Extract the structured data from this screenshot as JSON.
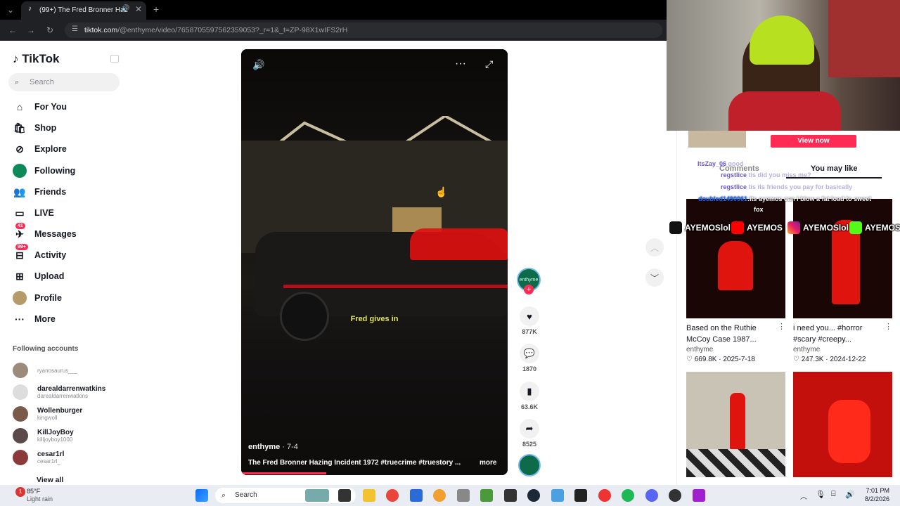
{
  "browser": {
    "tab_title": "(99+) The Fred Bronner Haz",
    "url_main": "tiktok.com",
    "url_rest": "/@enthyme/video/7658705597562359053?_r=1&_t=ZP-98X1wIFS2rH"
  },
  "sidebar": {
    "logo": "TikTok",
    "search_placeholder": "Search",
    "items": [
      {
        "label": "For You",
        "icon": "home-icon"
      },
      {
        "label": "Shop",
        "icon": "shop-icon"
      },
      {
        "label": "Explore",
        "icon": "compass-icon"
      },
      {
        "label": "Following",
        "icon": "following-icon"
      },
      {
        "label": "Friends",
        "icon": "friends-icon"
      },
      {
        "label": "LIVE",
        "icon": "live-icon"
      },
      {
        "label": "Messages",
        "icon": "messages-icon",
        "badge": "41"
      },
      {
        "label": "Activity",
        "icon": "activity-icon",
        "badge": "99+"
      },
      {
        "label": "Upload",
        "icon": "upload-icon"
      },
      {
        "label": "Profile",
        "icon": "profile-icon"
      },
      {
        "label": "More",
        "icon": "more-icon"
      }
    ],
    "following_title": "Following accounts",
    "following": [
      {
        "name": "",
        "user": "ryanosaurus___"
      },
      {
        "name": "darealdarrenwatkins",
        "user": "darealdarrenwatkins"
      },
      {
        "name": "Wollenburger",
        "user": "kingwoll"
      },
      {
        "name": "KillJoyBoy",
        "user": "killjoyboy1000"
      },
      {
        "name": "cesar1rl",
        "user": "cesar1rl_"
      }
    ],
    "view_all": "View all"
  },
  "video": {
    "caption_overlay": "Fred gives in",
    "author": "enthyme",
    "date": " · 7-4",
    "description": "The Fred Bronner Hazing Incident 1972 #truecrime #truestory ...",
    "more": "more",
    "progress": 0.32
  },
  "actions": {
    "author_avatar": "enthyme",
    "likes": "877K",
    "comments": "1870",
    "saves": "63.6K",
    "shares": "8525"
  },
  "right_panel": {
    "view_now": "View now",
    "tab_comments": "Comments",
    "tab_you_may_like": "You may like",
    "chat": [
      {
        "user": "ItsZay_06",
        "text": "good",
        "color": "#6a5acd"
      },
      {
        "user": "regstlice",
        "text": "tis did you miss me?",
        "color": "#6a5acd"
      },
      {
        "user": "regstlice",
        "text": "tis its friends you pay for basically",
        "color": "#6a5acd"
      },
      {
        "user": "doubled1490061",
        "text": ":its ayemos can i blow a fat load to sweet",
        "color": "#1e6cff"
      },
      {
        "user": "",
        "text": "fox",
        "color": "#ffffff"
      }
    ],
    "cards": [
      {
        "title": "Based on the Ruthie McCoy Case 1987...",
        "author": "enthyme",
        "likes": "669.8K",
        "date": "2025-7-18"
      },
      {
        "title": "i need you... #horror #scary #creepy...",
        "author": "enthyme",
        "likes": "247.3K",
        "date": "2024-12-22"
      },
      {
        "title": "",
        "author": "",
        "likes": "",
        "date": ""
      },
      {
        "title": "",
        "author": "",
        "likes": "",
        "date": ""
      }
    ]
  },
  "socials": [
    {
      "label": "AYEMOSlol",
      "icon": "tiktok-icon"
    },
    {
      "label": "AYEMOS",
      "icon": "youtube-icon"
    },
    {
      "label": "AYEMOSlol",
      "icon": "instagram-icon"
    },
    {
      "label": "AYEMOS",
      "icon": "kick-icon"
    }
  ],
  "taskbar": {
    "weather_temp": "85°F",
    "weather_desc": "Light rain",
    "search": "Search",
    "time": "7:01 PM",
    "date": "8/2/2026"
  }
}
